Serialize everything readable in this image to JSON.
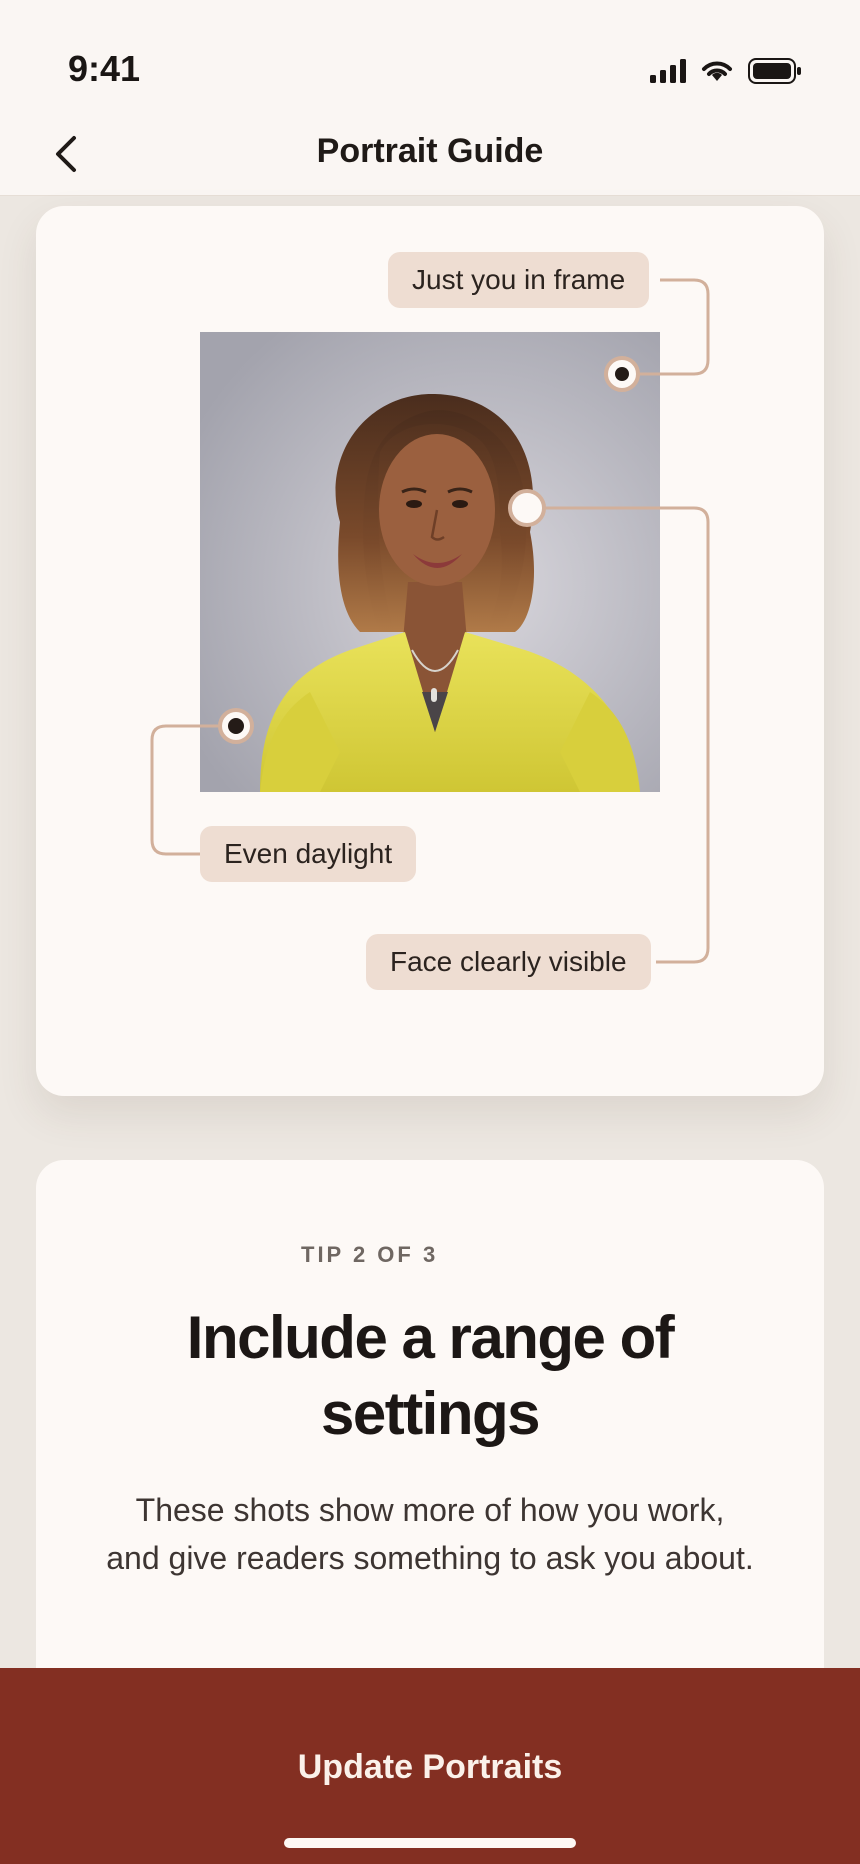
{
  "status_bar": {
    "time": "9:41",
    "icons": [
      "signal-icon",
      "wifi-icon",
      "battery-icon"
    ]
  },
  "nav": {
    "back_icon": "chevron-left-icon",
    "title": "Portrait Guide"
  },
  "example_card": {
    "photo_alt": "Example portrait of a smiling woman in a yellow top",
    "callouts": [
      {
        "label": "Just you in frame"
      },
      {
        "label": "Even daylight"
      },
      {
        "label": "Face clearly visible"
      }
    ]
  },
  "tip_card": {
    "eyebrow": "TIP 2 OF 3",
    "title": "Include a range of settings",
    "body": "These shots show more of how you work, and give readers something to ask you about."
  },
  "cta": {
    "label": "Update Portraits"
  },
  "colors": {
    "accent": "#832f22",
    "callout_fill": "#eeddd2",
    "callout_line": "#d2b09b",
    "background": "#ece7e1",
    "card": "#fdf9f6"
  }
}
